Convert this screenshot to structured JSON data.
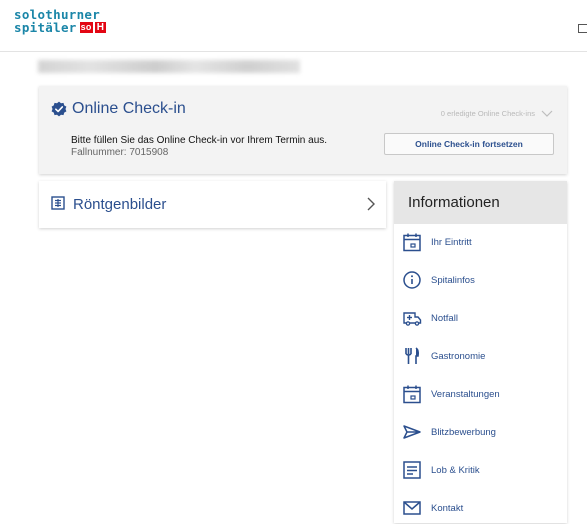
{
  "header": {
    "logo_line1": "solothurner",
    "logo_line2": "spitäler",
    "logo_badge_so": "so",
    "logo_badge_h": "H"
  },
  "checkin": {
    "title": "Online Check-in",
    "status": "0 erledigte Online Check-ins",
    "description": "Bitte füllen Sie das Online Check-in vor Ihrem Termin aus.",
    "case_number": "Fallnummer: 7015908",
    "button_label": "Online Check-in fortsetzen"
  },
  "xray": {
    "label": "Röntgenbilder"
  },
  "info": {
    "heading": "Informationen",
    "items": [
      {
        "label": "Ihr Eintritt",
        "icon": "calendar-icon"
      },
      {
        "label": "Spitalinfos",
        "icon": "info-icon"
      },
      {
        "label": "Notfall",
        "icon": "ambulance-icon"
      },
      {
        "label": "Gastronomie",
        "icon": "cutlery-icon"
      },
      {
        "label": "Veranstaltungen",
        "icon": "calendar-icon"
      },
      {
        "label": "Blitzbewerbung",
        "icon": "send-icon"
      },
      {
        "label": "Lob & Kritik",
        "icon": "feedback-icon"
      },
      {
        "label": "Kontakt",
        "icon": "mail-icon"
      }
    ]
  },
  "colors": {
    "accent": "#2b4f8e",
    "logo": "#1b86a8",
    "logo_badge": "#e30613"
  }
}
